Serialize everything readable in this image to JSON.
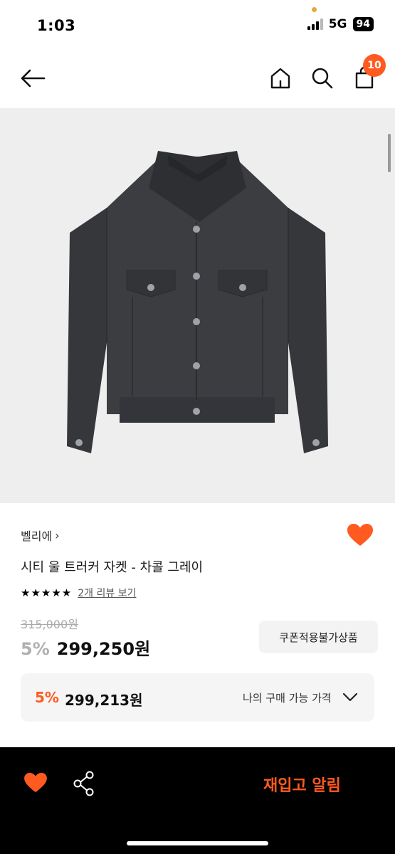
{
  "status_bar": {
    "time": "1:03",
    "network": "5G",
    "battery": "94"
  },
  "header": {
    "cart_count": "10"
  },
  "product": {
    "brand": "벨리에",
    "brand_chevron": "›",
    "title": "시티 울 트러커 자켓 - 차콜 그레이",
    "stars": "★★★★★",
    "review_link": "2개 리뷰 보기",
    "original_price": "315,000원",
    "discount": "5%",
    "price": "299,250원",
    "coupon_label": "쿠폰적용불가상품"
  },
  "my_price": {
    "discount": "5%",
    "price": "299,213원",
    "label": "나의 구매 가능 가격"
  },
  "bottom_bar": {
    "restock_label": "재입고 알림"
  },
  "colors": {
    "accent": "#ff5a1f",
    "jacket": "#3a3b3f",
    "image_bg": "#eeeeee"
  },
  "icons": [
    "back-arrow-icon",
    "home-icon",
    "search-icon",
    "cart-icon",
    "heart-icon",
    "share-icon",
    "chevron-down-icon"
  ]
}
